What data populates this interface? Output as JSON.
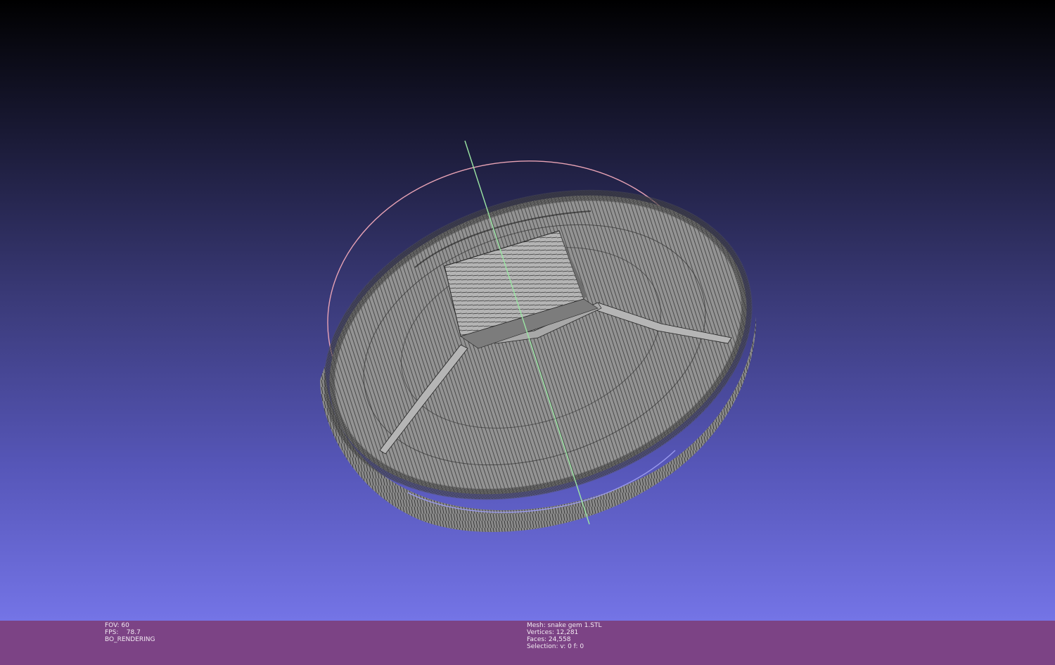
{
  "viewer": {
    "mesh_color": "#8a8a8a",
    "wire_color": "#2c2c2c",
    "trackball_colors": {
      "x": "#e8a3b5",
      "y": "#9be6a4",
      "z": "#9a9aee"
    },
    "background_top": "#000000",
    "background_bottom": "#7474e6"
  },
  "render_info": {
    "fov": "FOV: 60",
    "fps": "FPS:    78.7",
    "mode": "BO_RENDERING"
  },
  "mesh_info": {
    "mesh": "Mesh: snake gem 1.STL",
    "vertices": "Vertices: 12,281",
    "faces": "Faces: 24,558",
    "selection": "Selection: v: 0 f: 0"
  },
  "statusbar_color": "#7c4385"
}
